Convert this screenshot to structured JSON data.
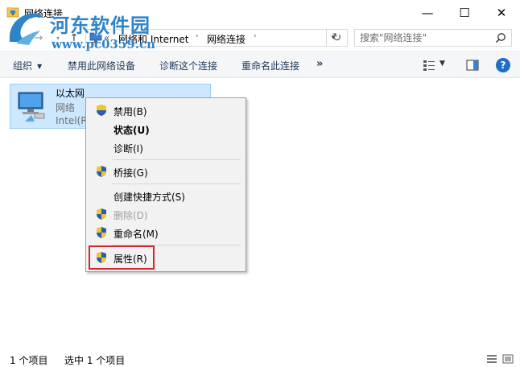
{
  "window": {
    "title": "网络连接",
    "minimize_glyph": "—",
    "maximize_glyph": "☐",
    "close_glyph": "✕"
  },
  "watermark": {
    "name": "河东软件园",
    "url": "www.pc0359.cn"
  },
  "nav": {
    "back_glyph": "←",
    "forward_glyph": "→",
    "recent_glyph": "▾",
    "up_glyph": "↑"
  },
  "address": {
    "overflow": "«",
    "crumbs": [
      "网络和 Internet",
      "网络连接"
    ],
    "separator": "›",
    "dropdown_glyph": "▾",
    "refresh_glyph": "↻"
  },
  "search": {
    "placeholder": "搜索\"网络连接\""
  },
  "toolbar": {
    "organize": "组织",
    "organize_caret": "▼",
    "disable_device": "禁用此网络设备",
    "diagnose": "诊断这个连接",
    "rename": "重命名此连接",
    "more": "»",
    "view_caret": "▼",
    "help": "?"
  },
  "connection": {
    "name": "以太网",
    "status": "网络",
    "device": "Intel(R"
  },
  "context_menu": {
    "items": [
      {
        "label": "禁用(B)",
        "shield": true,
        "bold": false,
        "disabled": false
      },
      {
        "label": "状态(U)",
        "shield": false,
        "bold": true,
        "disabled": false
      },
      {
        "label": "诊断(I)",
        "shield": false,
        "bold": false,
        "disabled": false
      },
      {
        "label": "桥接(G)",
        "shield": true,
        "bold": false,
        "disabled": false
      },
      {
        "label": "创建快捷方式(S)",
        "shield": false,
        "bold": false,
        "disabled": false
      },
      {
        "label": "删除(D)",
        "shield": true,
        "bold": false,
        "disabled": true
      },
      {
        "label": "重命名(M)",
        "shield": true,
        "bold": false,
        "disabled": false
      },
      {
        "label": "属性(R)",
        "shield": true,
        "bold": false,
        "disabled": false
      }
    ]
  },
  "status": {
    "item_count": "1 个项目",
    "selected": "选中 1 个项目"
  },
  "colors": {
    "accent": "#1f6fc5",
    "selection": "#cce8ff",
    "highlight_box": "#d4262a",
    "watermark": "#2f83c9"
  },
  "icons": {
    "app": "network-folder-icon",
    "connection": "ethernet-adapter-icon",
    "uac": "uac-shield-icon",
    "search": "search-icon"
  }
}
